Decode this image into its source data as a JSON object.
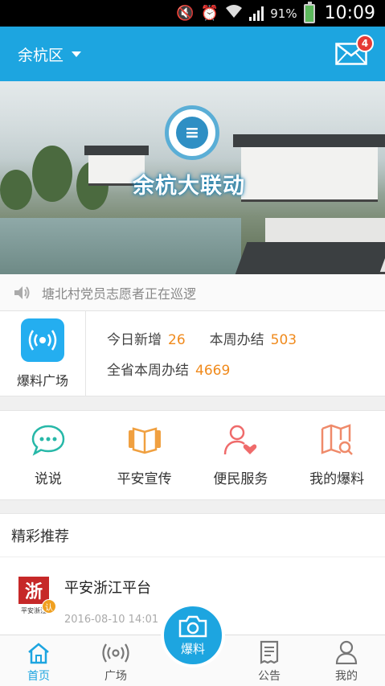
{
  "status_bar": {
    "battery_percent": "91%",
    "time": "10:09",
    "icons": [
      "mute-icon",
      "alarm-icon",
      "wifi-icon",
      "signal-icon",
      "battery-icon"
    ]
  },
  "header": {
    "region": "余杭区",
    "mail_badge": "4",
    "bg_color": "#1da5e0"
  },
  "banner": {
    "title": "余杭大联动"
  },
  "notice": {
    "text": "塘北村党员志愿者正在巡逻"
  },
  "stats": {
    "plaza_label": "爆料广场",
    "today_new_label": "今日新增",
    "today_new_value": "26",
    "week_done_label": "本周办结",
    "week_done_value": "503",
    "province_week_label": "全省本周办结",
    "province_week_value": "4669"
  },
  "quick_actions": [
    {
      "label": "说说",
      "icon": "chat-bubble-icon",
      "color": "#27b8a8"
    },
    {
      "label": "平安宣传",
      "icon": "open-book-icon",
      "color": "#f0a040"
    },
    {
      "label": "便民服务",
      "icon": "person-heart-icon",
      "color": "#ef6b6b"
    },
    {
      "label": "我的爆料",
      "icon": "map-search-icon",
      "color": "#ef8a6a"
    }
  ],
  "recommend": {
    "heading": "精彩推荐",
    "items": [
      {
        "title": "平安浙江平台",
        "time": "2016-08-10 14:01",
        "logo_char": "浙",
        "logo_caption": "平安浙江",
        "verified_mark": "认"
      }
    ]
  },
  "bottom_nav": {
    "home": "首页",
    "plaza": "广场",
    "report": "爆料",
    "notice": "公告",
    "mine": "我的",
    "active": "home"
  }
}
